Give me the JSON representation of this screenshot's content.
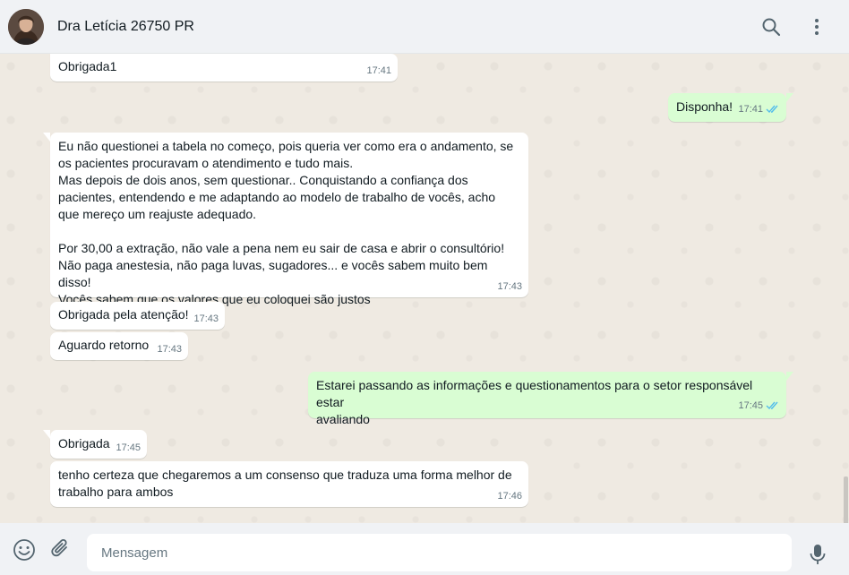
{
  "header": {
    "contact_name": "Dra Letícia 26750 PR",
    "icons": [
      "search-icon",
      "menu-icon"
    ]
  },
  "colors": {
    "header_bg": "#f0f2f5",
    "chat_bg": "#efeae2",
    "incoming_bubble": "#ffffff",
    "outgoing_bubble": "#d9fdd3",
    "read_ticks": "#53bdeb",
    "meta_text": "#667781"
  },
  "messages": [
    {
      "direction": "in",
      "text": "Obrigada1",
      "time": "17:41"
    },
    {
      "direction": "out",
      "text": "Disponha!",
      "time": "17:41",
      "read": true
    },
    {
      "direction": "in",
      "text": "Eu não questionei a tabela no começo, pois queria ver como era o andamento, se\nos pacientes procuravam o atendimento e tudo mais.\nMas depois de dois anos, sem questionar.. Conquistando a confiança dos\npacientes, entendendo e me adaptando ao modelo de trabalho de vocês, acho\nque mereço um reajuste adequado.\n\nPor 30,00 a extração, não vale a pena nem eu sair de casa e abrir o consultório!\nNão paga anestesia, não paga luvas, sugadores... e vocês sabem muito bem disso!\nVocês sabem que os valores que eu coloquei são justos",
      "time": "17:43"
    },
    {
      "direction": "in",
      "text": "Obrigada pela atenção!",
      "time": "17:43"
    },
    {
      "direction": "in",
      "text": "Aguardo retorno",
      "time": "17:43"
    },
    {
      "direction": "out",
      "text": "Estarei passando as informações e questionamentos para o setor responsável estar\navaliando",
      "time": "17:45",
      "read": true
    },
    {
      "direction": "in",
      "text": "Obrigada",
      "time": "17:45"
    },
    {
      "direction": "in",
      "text": "tenho certeza que chegaremos a um consenso que traduza uma forma melhor de\ntrabalho para ambos",
      "time": "17:46"
    }
  ],
  "footer": {
    "input_placeholder": "Mensagem",
    "icons": [
      "emoji-icon",
      "attach-icon",
      "mic-icon"
    ]
  }
}
